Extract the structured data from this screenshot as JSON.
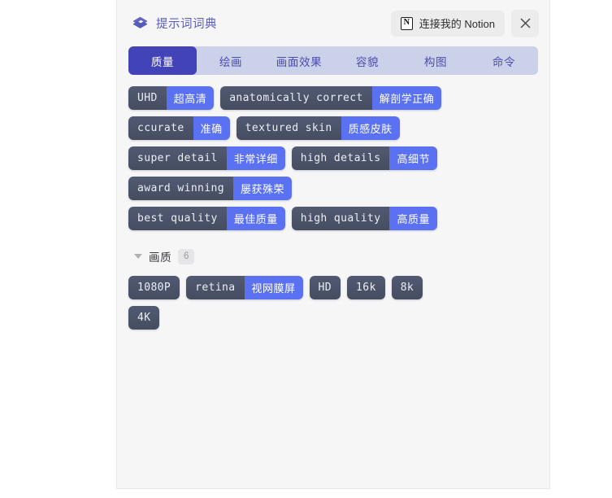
{
  "header": {
    "icon": "book-icon",
    "title": "提示词词典",
    "notion_button": {
      "icon": "notion-icon",
      "icon_glyph": "N",
      "label": "连接我的 Notion"
    },
    "close_label": "close-icon"
  },
  "tabs": [
    {
      "label": "质量",
      "active": true
    },
    {
      "label": "绘画",
      "active": false
    },
    {
      "label": "画面效果",
      "active": false
    },
    {
      "label": "容貌",
      "active": false
    },
    {
      "label": "构图",
      "active": false
    },
    {
      "label": "命令",
      "active": false
    }
  ],
  "primary_tags": [
    {
      "en": "UHD",
      "cn": "超高清"
    },
    {
      "en": "anatomically correct",
      "cn": "解剖学正确"
    },
    {
      "en": "ccurate",
      "cn": "准确"
    },
    {
      "en": "textured skin",
      "cn": "质感皮肤"
    },
    {
      "en": "super detail",
      "cn": "非常详细"
    },
    {
      "en": "high details",
      "cn": "高细节"
    },
    {
      "en": "award winning",
      "cn": "屡获殊荣"
    },
    {
      "en": "best quality",
      "cn": "最佳质量"
    },
    {
      "en": "high quality",
      "cn": "高质量"
    }
  ],
  "section": {
    "title": "画质",
    "count": "6",
    "expanded": true,
    "tags": [
      {
        "en": "1080P",
        "cn": ""
      },
      {
        "en": "retina",
        "cn": "视网膜屏"
      },
      {
        "en": "HD",
        "cn": ""
      },
      {
        "en": "16k",
        "cn": ""
      },
      {
        "en": "8k",
        "cn": ""
      },
      {
        "en": "4K",
        "cn": ""
      }
    ]
  },
  "colors": {
    "page_background": "#ffffff",
    "panel_background": "#f6f6f7",
    "tab_bar_background": "#ccd1ea",
    "tab_active_background": "#4343b8",
    "tab_inactive_text": "#4b4bb0",
    "title_color": "#5b5bbd",
    "tag_english_background": "#4b5268",
    "tag_chinese_background": "#5a71f2",
    "button_background": "#ececec"
  }
}
